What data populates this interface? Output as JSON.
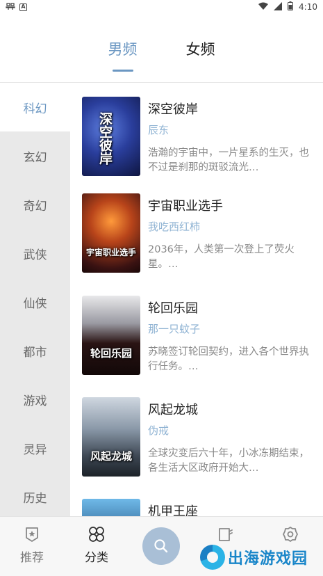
{
  "status_bar": {
    "time": "4:10",
    "left_icons": [
      "app-notification-icon",
      "a-box-icon"
    ],
    "right_icons": [
      "wifi-icon",
      "signal-icon",
      "battery-icon"
    ]
  },
  "top_tabs": [
    {
      "label": "男频",
      "active": true
    },
    {
      "label": "女频",
      "active": false
    }
  ],
  "categories": [
    {
      "label": "科幻",
      "active": true
    },
    {
      "label": "玄幻",
      "active": false
    },
    {
      "label": "奇幻",
      "active": false
    },
    {
      "label": "武侠",
      "active": false
    },
    {
      "label": "仙侠",
      "active": false
    },
    {
      "label": "都市",
      "active": false
    },
    {
      "label": "游戏",
      "active": false
    },
    {
      "label": "灵异",
      "active": false
    },
    {
      "label": "历史",
      "active": false
    }
  ],
  "books": [
    {
      "title": "深空彼岸",
      "author": "辰东",
      "description": "浩瀚的宇宙中，一片星系的生灭，也不过是刹那的斑驳流光…",
      "cover_title": "深空彼岸"
    },
    {
      "title": "宇宙职业选手",
      "author": "我吃西红柿",
      "description": "2036年，人类第一次登上了荧火星。…",
      "cover_title": "宇宙职业选手"
    },
    {
      "title": "轮回乐园",
      "author": "那一只蚊子",
      "description": "苏晓签订轮回契约，进入各个世界执行任务。…",
      "cover_title": "轮回乐园"
    },
    {
      "title": "风起龙城",
      "author": "伪戒",
      "description": "全球灾变后六十年，小冰冻期结束，各生活大区政府开始大…",
      "cover_title": "风起龙城"
    },
    {
      "title": "机甲王座",
      "author": "",
      "description": "",
      "cover_title": ""
    }
  ],
  "bottom_nav": {
    "items": [
      {
        "label": "推荐",
        "icon": "recommend-icon",
        "active": false
      },
      {
        "label": "分类",
        "icon": "category-icon",
        "active": true
      },
      {
        "label": "",
        "icon": "bookshelf-icon",
        "active": false
      },
      {
        "label": "",
        "icon": "settings-icon",
        "active": false
      }
    ],
    "search_icon": "search-icon"
  },
  "watermark": {
    "text": "出海游戏园"
  },
  "colors": {
    "accent": "#6b97c2",
    "author": "#8fb3d3",
    "sidebar_bg": "#e9e9e9",
    "search_button": "#a9bfd6"
  }
}
